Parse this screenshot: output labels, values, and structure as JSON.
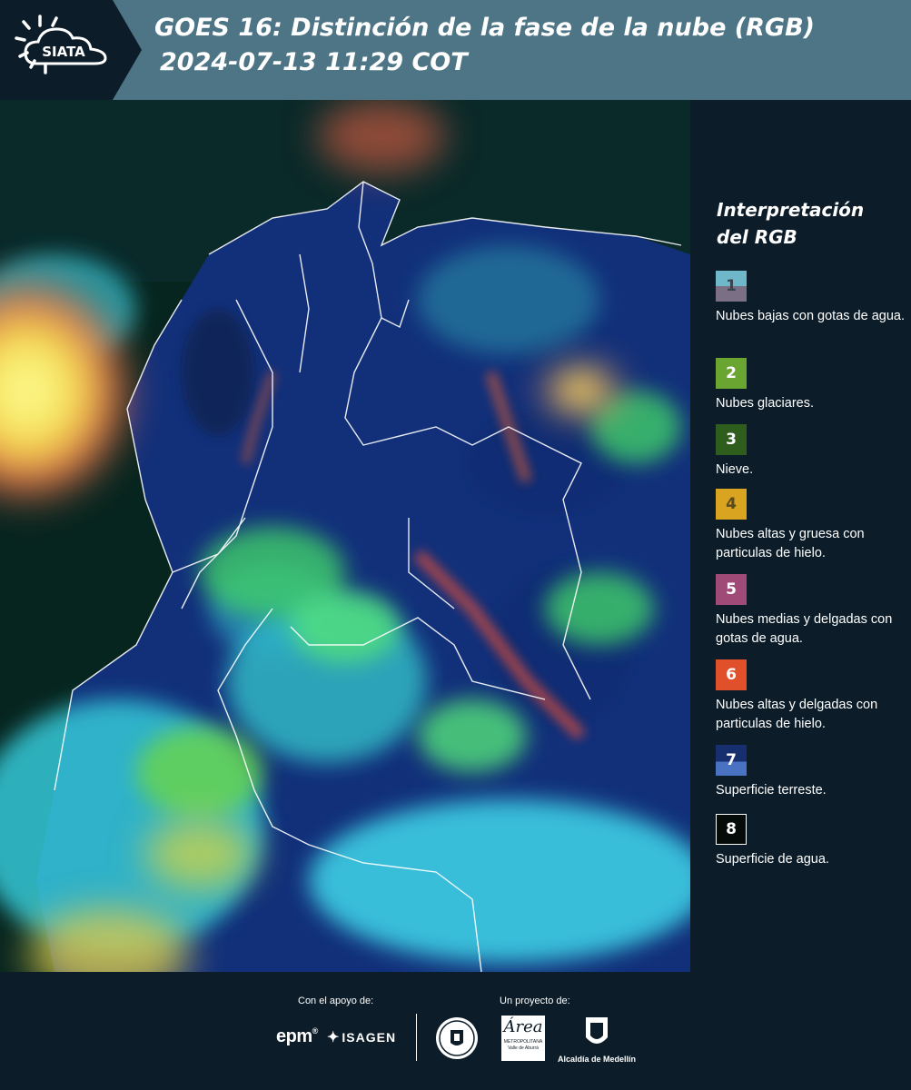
{
  "header": {
    "brand": "SIATA",
    "title": "GOES 16: Distinción de la fase de la nube (RGB)",
    "datetime": "2024-07-13 11:29 COT"
  },
  "legend": {
    "title_line1": "Interpretación",
    "title_line2": "del RGB",
    "items": [
      {
        "number": "1",
        "label": "Nubes bajas con gotas de agua.",
        "color_top": "#6fb8c9",
        "color_bottom": "#7b6f86"
      },
      {
        "number": "2",
        "label": "Nubes glaciares.",
        "color_top": "#6aa532",
        "color_bottom": "#6aa532"
      },
      {
        "number": "3",
        "label": "Nieve.",
        "color_top": "#2e5d1d",
        "color_bottom": "#2e5d1d"
      },
      {
        "number": "4",
        "label": "Nubes altas y gruesa con particulas de hielo.",
        "color_top": "#d9a520",
        "color_bottom": "#d9a520"
      },
      {
        "number": "5",
        "label": "Nubes medias y delgadas con gotas de agua.",
        "color_top": "#a04a78",
        "color_bottom": "#a04a78"
      },
      {
        "number": "6",
        "label": "Nubes altas y delgadas con particulas de hielo.",
        "color_top": "#e0502a",
        "color_bottom": "#e0502a"
      },
      {
        "number": "7",
        "label": "Superficie terreste.",
        "color_top": "#172f6e",
        "color_bottom": "#4a72c2"
      },
      {
        "number": "8",
        "label": "Superficie de agua.",
        "color_top": "#050b08",
        "color_bottom": "#050b08"
      }
    ]
  },
  "footer": {
    "support_caption": "Con el apoyo de:",
    "project_caption": "Un proyecto de:",
    "epm": "epm",
    "isagen": "ISAGEN",
    "area_line1": "METROPOLITANA",
    "area_line2": "Valle de Aburrá",
    "alcaldia": "Alcaldía de Medellín"
  }
}
